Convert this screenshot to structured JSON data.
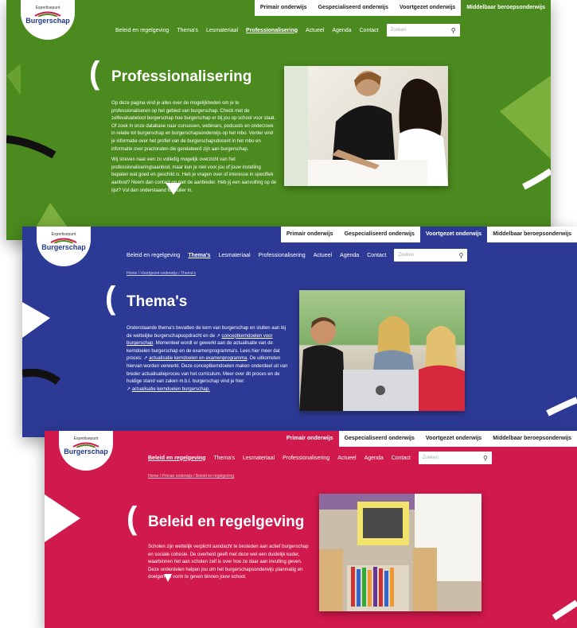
{
  "topnav": [
    "Primair onderwijs",
    "Gespecialiseerd onderwijs",
    "Voortgezet onderwijs",
    "Middelbaar beroepsonderwijs"
  ],
  "mainnav": [
    "Beleid en regelgeving",
    "Thema's",
    "Lesmateriaal",
    "Professionalisering",
    "Actueel",
    "Agenda",
    "Contact"
  ],
  "logo": {
    "small": "Expertisepunt",
    "big": "Burgerschap"
  },
  "search_placeholder": "Zoeken",
  "card1": {
    "title": "Professionalisering",
    "p1": "Op deze pagina vind je alles over de mogelijkheden om je te professionaliseren op het gebied van burgerschap. Check met de zelfevaluatietool burgerschap hoe burgerschap er bij jou op school voor staat. Of zoek in onze database naar cursussen, webinars, podcasts en onderzoek in relatie tot burgerschap en burgerschapsonderwijs op het mbo. Verder vind je informatie over het profiel van de burgerschapsdocent in het mbo en informatie over practoraten die gerelateerd zijn aan burgerschap.",
    "p2": "Wij streven naar een zo volledig mogelijk overzicht van het professionaliseringsaanbod, maar kun je niet voor jou of jouw instelling bepalen wat goed en geschikt is. Heb je vragen over of interesse in specifiek aanbod? Neem dan contact op met de aanbieder. Heb jij een aanvulling op de lijst? Vul dan onderstaand formulier in."
  },
  "card2": {
    "crumb": "Home  /  Voortgezet onderwijs  /  Thema's",
    "title": "Thema's",
    "t1": "Onderstaande thema's bevatten de kern van burgerschap en sluiten aan bij de wettelijke burgerschapsopdracht en de",
    "l1": "conceptkerndoelen voor burgerschap",
    "t2": ". Momenteel wordt er gewerkt aan de actualisatie van de kerndoelen burgerschap en de examenprogramma's. Lees hier meer dat proces:",
    "l2": "actualisatie kerndoelen en examenprogramma",
    "t3": ". De uitkomsten hiervan worden verwerkt. Deze conceptkerndoelen maken onderdeel uit van breder actualisatieproces van het curriculum. Meer over dit proces en de huidige stand van zaken m.b.t. burgerschap vind je hier:",
    "l3": "actualisatie kerndoelen burgerschap."
  },
  "card3": {
    "crumb": "Home  /  Primair onderwijs  /  Beleid en regelgeving",
    "title": "Beleid en regelgeving",
    "p1": "Scholen zijn wettelijk verplicht aandacht te besteden aan actief burgerschap en sociale cohesie. De overheid geeft met deze wet een duidelijk kader, waarbinnen het aan scholen zelf is over hoe ze daar aan invulling geven. Deze onderdelen helpen jou om het burgerschapsonderwijs planmatig en doelgericht vorm te geven binnen jouw school."
  },
  "colors": {
    "green": "#4b8a1e",
    "blue": "#2d3a95",
    "red": "#d0194c"
  },
  "icons": {
    "search": "search-icon",
    "link": "external-link-icon"
  }
}
